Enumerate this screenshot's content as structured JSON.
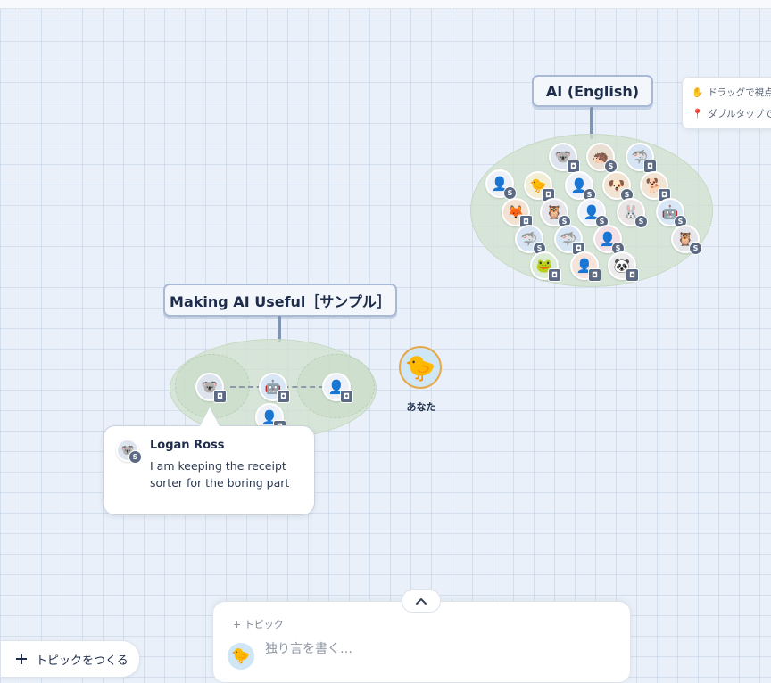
{
  "topics": {
    "ai_english": {
      "title": "AI (English)"
    },
    "making_ai_useful": {
      "title": "Making AI Useful［サンプル］"
    }
  },
  "you": {
    "label": "あなた",
    "icon": "chick"
  },
  "bubble": {
    "name": "Logan Ross",
    "text": "I am keeping the receipt sorter for the boring part"
  },
  "hint": {
    "drag": "ドラッグで視点",
    "double_tap": "ダブルタップで"
  },
  "composer": {
    "topic_label": "+ トピック",
    "placeholder": "独り言を書く…"
  },
  "create_topic": {
    "label": "トピックをつくる"
  },
  "badges": {
    "chat": "◘",
    "s": "S"
  }
}
